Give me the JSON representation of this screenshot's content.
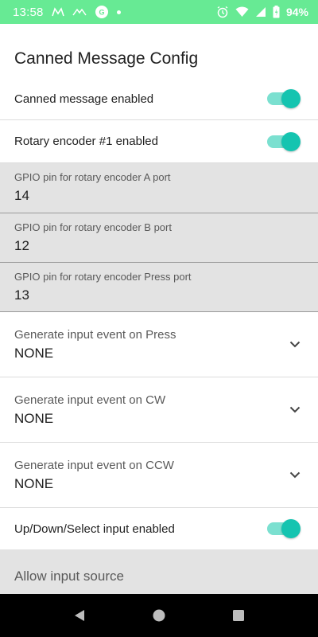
{
  "status_bar": {
    "time": "13:58",
    "battery_pct": "94%",
    "background": "#67ea94",
    "left_icons": [
      "sim-m-icon",
      "signal-wave-icon",
      "app-badge-icon",
      "notification-dot-icon"
    ],
    "right_icons": [
      "alarm-icon",
      "wifi-icon",
      "signal-icon",
      "battery-icon"
    ],
    "app_badge_text": "G"
  },
  "page": {
    "title": "Canned Message Config"
  },
  "toggles": {
    "canned_enabled": {
      "label": "Canned message enabled",
      "on": true
    },
    "rotary_enabled": {
      "label": "Rotary encoder #1 enabled",
      "on": true
    },
    "updown_enabled": {
      "label": "Up/Down/Select input enabled",
      "on": true
    }
  },
  "fields": {
    "pin_a": {
      "label": "GPIO pin for rotary encoder A port",
      "value": "14"
    },
    "pin_b": {
      "label": "GPIO pin for rotary encoder B port",
      "value": "12"
    },
    "pin_press": {
      "label": "GPIO pin for rotary encoder Press port",
      "value": "13"
    }
  },
  "dropdowns": {
    "event_press": {
      "label": "Generate input event on Press",
      "value": "NONE"
    },
    "event_cw": {
      "label": "Generate input event on CW",
      "value": "NONE"
    },
    "event_ccw": {
      "label": "Generate input event on CCW",
      "value": "NONE"
    }
  },
  "allow_input_source": {
    "label": "Allow input source"
  },
  "colors": {
    "switch_track": "#7be0d0",
    "switch_knob": "#15c4b0",
    "field_bg": "#e3e3e3"
  },
  "nav": {
    "icons": [
      "back-icon",
      "home-icon",
      "recents-icon"
    ]
  }
}
